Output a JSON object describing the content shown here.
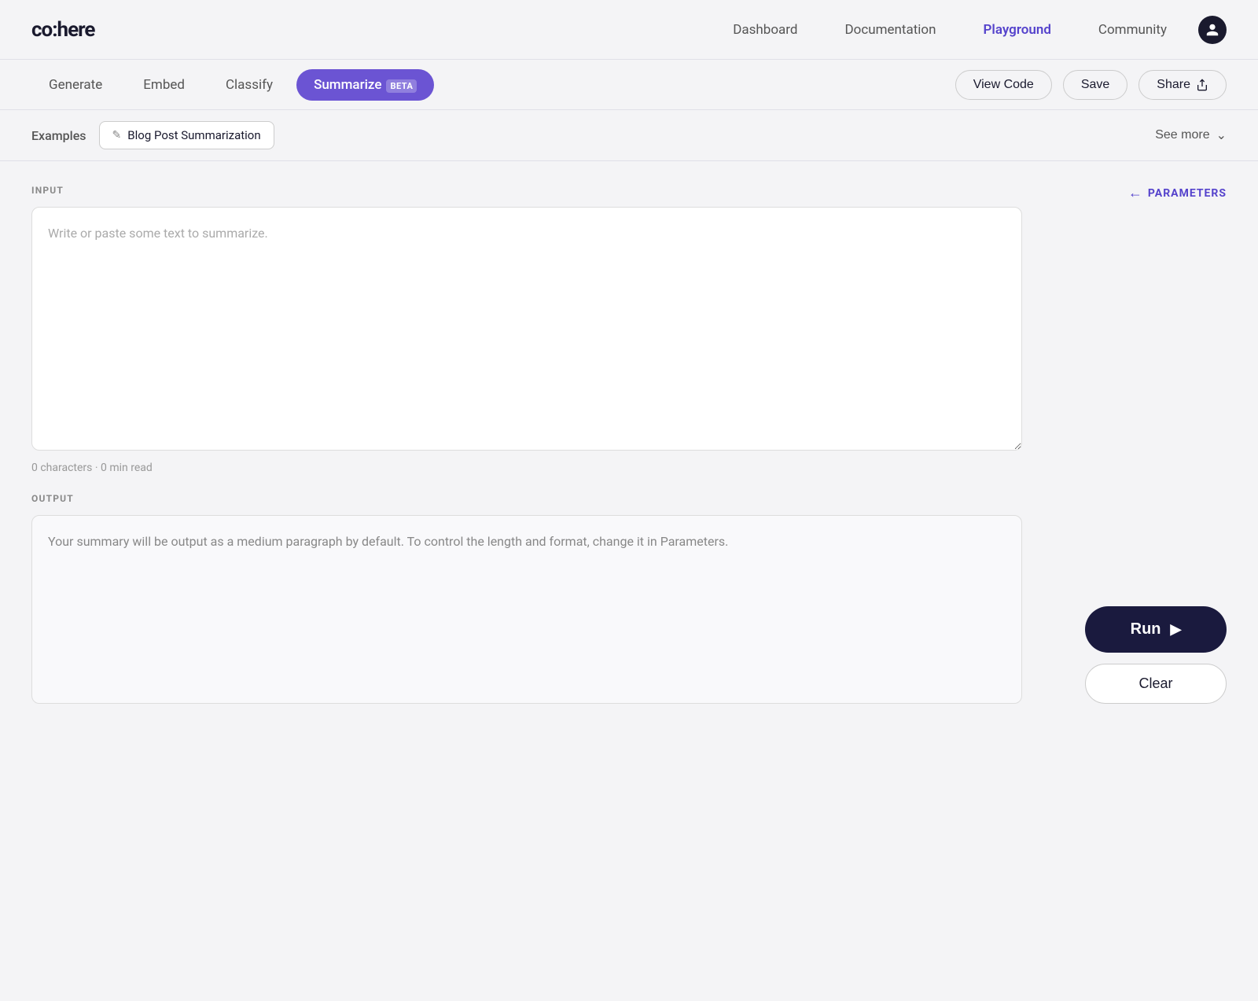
{
  "nav": {
    "logo": "co:here",
    "links": [
      {
        "id": "dashboard",
        "label": "Dashboard",
        "active": false
      },
      {
        "id": "documentation",
        "label": "Documentation",
        "active": false
      },
      {
        "id": "playground",
        "label": "Playground",
        "active": true
      },
      {
        "id": "community",
        "label": "Community",
        "active": false
      }
    ],
    "avatar_icon": "👤"
  },
  "tabs": {
    "items": [
      {
        "id": "generate",
        "label": "Generate",
        "active": false
      },
      {
        "id": "embed",
        "label": "Embed",
        "active": false
      },
      {
        "id": "classify",
        "label": "Classify",
        "active": false
      },
      {
        "id": "summarize",
        "label": "Summarize",
        "active": true,
        "badge": "BETA"
      }
    ],
    "view_code_label": "View Code",
    "save_label": "Save",
    "share_label": "Share"
  },
  "examples": {
    "label": "Examples",
    "chips": [
      {
        "id": "blog-post",
        "label": "Blog Post Summarization"
      }
    ],
    "see_more_label": "See more"
  },
  "input": {
    "section_label": "INPUT",
    "placeholder": "Write or paste some text to summarize.",
    "char_count": "0 characters · 0 min read"
  },
  "output": {
    "section_label": "OUTPUT",
    "placeholder_text": "Your summary will be output as a medium paragraph by default. To control the length and format, change it in Parameters."
  },
  "parameters": {
    "label": "PARAMETERS",
    "arrow": "←"
  },
  "actions": {
    "run_label": "Run",
    "clear_label": "Clear"
  }
}
